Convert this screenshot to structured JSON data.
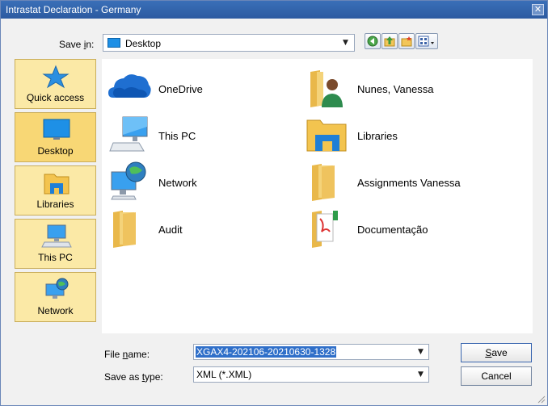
{
  "window": {
    "title": "Intrastat Declaration - Germany",
    "close_glyph": "✕"
  },
  "toolbar": {
    "save_in_label_pre": "Save ",
    "save_in_label_u": "i",
    "save_in_label_post": "n:",
    "save_in_value": "Desktop",
    "buttons": [
      {
        "name": "back-icon"
      },
      {
        "name": "up-folder-icon"
      },
      {
        "name": "new-folder-icon"
      },
      {
        "name": "view-menu-icon"
      }
    ]
  },
  "places": [
    {
      "label": "Quick access",
      "icon": "star-icon",
      "active": false
    },
    {
      "label": "Desktop",
      "icon": "desktop-icon",
      "active": true
    },
    {
      "label": "Libraries",
      "icon": "libraries-icon",
      "active": false
    },
    {
      "label": "This PC",
      "icon": "computer-icon",
      "active": false
    },
    {
      "label": "Network",
      "icon": "network-icon",
      "active": false
    }
  ],
  "items": [
    {
      "name": "OneDrive",
      "icon": "onedrive-icon"
    },
    {
      "name": "Nunes, Vanessa",
      "icon": "user-folder-icon"
    },
    {
      "name": "This PC",
      "icon": "computer-icon"
    },
    {
      "name": "Libraries",
      "icon": "libraries-icon"
    },
    {
      "name": "Network",
      "icon": "network-icon"
    },
    {
      "name": "Assignments Vanessa",
      "icon": "folder-icon"
    },
    {
      "name": "Audit",
      "icon": "folder-icon"
    },
    {
      "name": "Documentação",
      "icon": "pdf-folder-icon"
    }
  ],
  "form": {
    "file_name_label_pre": "File ",
    "file_name_label_u": "n",
    "file_name_label_post": "ame:",
    "file_name_value": "XGAX4-202106-20210630-1328",
    "save_type_label_pre": "Save as ",
    "save_type_label_u": "t",
    "save_type_label_post": "ype:",
    "save_type_value": "XML (*.XML)",
    "save_pre": "",
    "save_u": "S",
    "save_post": "ave",
    "cancel": "Cancel"
  },
  "colors": {
    "title_bar": "#2c5aa0",
    "place_bg": "#fbe9a6",
    "place_active_bg": "#f8d775",
    "selection": "#2f6fc9"
  }
}
